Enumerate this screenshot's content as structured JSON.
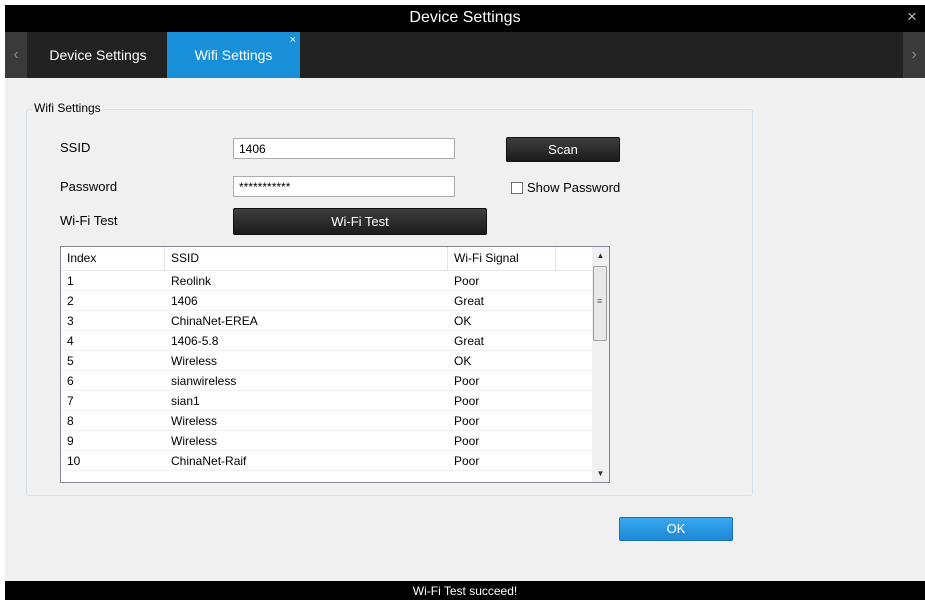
{
  "window": {
    "title": "Device Settings",
    "close_glyph": "×"
  },
  "tabs": [
    {
      "label": "Device Settings",
      "active": false
    },
    {
      "label": "Wifi Settings",
      "active": true,
      "close_glyph": "×"
    }
  ],
  "nav": {
    "left_glyph": "‹",
    "right_glyph": "›"
  },
  "wifi": {
    "group_title": "Wifi Settings",
    "ssid_label": "SSID",
    "ssid_value": "1406",
    "password_label": "Password",
    "password_value": "***********",
    "wifitest_label": "Wi-Fi Test",
    "scan_button": "Scan",
    "show_password_label": "Show Password",
    "show_password_checked": false,
    "wifitest_button": "Wi-Fi Test"
  },
  "table": {
    "columns": [
      "Index",
      "SSID",
      "Wi-Fi Signal",
      ""
    ],
    "rows": [
      {
        "index": "1",
        "ssid": "Reolink",
        "signal": "Poor"
      },
      {
        "index": "2",
        "ssid": "1406",
        "signal": "Great"
      },
      {
        "index": "3",
        "ssid": "ChinaNet-EREA",
        "signal": "OK"
      },
      {
        "index": "4",
        "ssid": "1406-5.8",
        "signal": "Great"
      },
      {
        "index": "5",
        "ssid": "Wireless",
        "signal": "OK"
      },
      {
        "index": "6",
        "ssid": "sianwireless",
        "signal": "Poor"
      },
      {
        "index": "7",
        "ssid": "sian1",
        "signal": "Poor"
      },
      {
        "index": "8",
        "ssid": "Wireless",
        "signal": "Poor"
      },
      {
        "index": "9",
        "ssid": "Wireless",
        "signal": "Poor"
      },
      {
        "index": "10",
        "ssid": "ChinaNet-Raif",
        "signal": "Poor"
      }
    ]
  },
  "ok_button": "OK",
  "status": "Wi-Fi Test succeed!",
  "colors": {
    "accent": "#1a8fd9",
    "titlebar": "#000000",
    "tabbar": "#222222",
    "background": "#f0f0f0"
  }
}
